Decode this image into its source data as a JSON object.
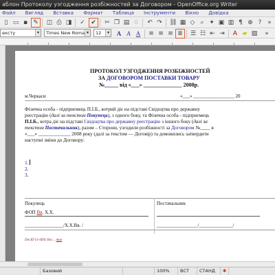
{
  "window": {
    "title": "аблон Протоколу узгодження розбіжностей за Договором - OpenOffice.org Writer"
  },
  "menu": [
    "Файл",
    "Вигляд",
    "Вставка",
    "Формат",
    "Таблиця",
    "Інструменти",
    "Вікно",
    "Довідка"
  ],
  "format_bar": {
    "style_value": "ексту",
    "font_value": "Times New Roman",
    "size_value": "12"
  },
  "document": {
    "title_line1": "ПРОТОКОЛ УЗГОДЖЕННЯ РОЗБІЖНОСТЕЙ",
    "title_line2_prefix": "ЗА ",
    "title_line2_link": "ДОГОВОРОМ ПОСТАВКИ ТОВАРУ",
    "title_line3": "№_____ від «___» ______________ 2008р.",
    "city": "м.Черкаси",
    "city_date": "«___» _________________ 20",
    "para": {
      "l1": "Фізична особа - підприємець П.І.Б., котрий діє на підставі Свідоцтва про державну",
      "l2a": "реєстрацію (",
      "l2b": "далі за текстом ",
      "l2c": "Покупець",
      "l2d": "), з одного боку, та Фізична особа - підприємець",
      "l3a": "П.І.Б.",
      "l3b": ", котра діє на підставі ",
      "l3c": "Свідоцтва про державну реєстрацію",
      "l3d": " з іншого боку (",
      "l3e": "далі за",
      "l4a": "текстом ",
      "l4b": "Постачальник",
      "l4c": "), разом – Сторони, узгодили розбіжності за ",
      "l4d": "Договором",
      "l4e": " №____ в",
      "l5": "«___» _____________ 2008 року (далі за текстом — Договір) та домовились затвердити",
      "l6": "наступні зміни до Договору:"
    },
    "list": [
      "1.",
      "2.",
      "3."
    ],
    "buyer_header": "Покупець",
    "supplier_header": "Постачальник",
    "fop_prefix": "ФОП ",
    "fop_red": "Вв",
    "fop_suffix": ". Х.Х.",
    "sign_buyer": "________________/Х.Х.Вв. /",
    "sign_supplier": "_________________/______________/",
    "footnote_a": "DocID  51-6692 Вос...",
    "footnote_b": "тип"
  },
  "status": {
    "style": "Базовий",
    "zoom": "100%",
    "mode": "ВСТ",
    "std": "СТАНД"
  }
}
